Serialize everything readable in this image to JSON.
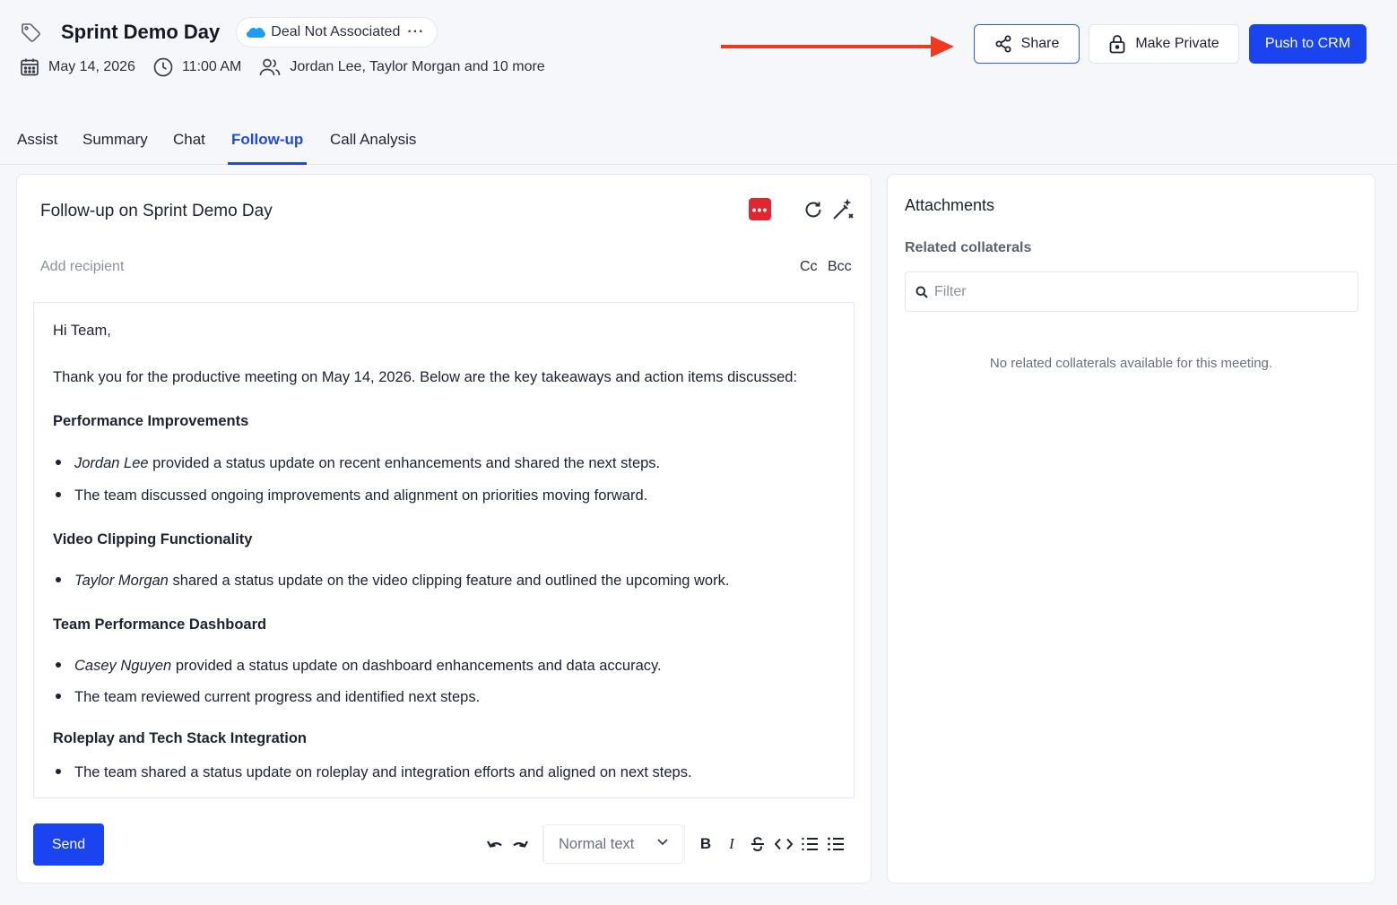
{
  "header": {
    "title": "Sprint Demo Day",
    "deal_status": "Deal Not Associated",
    "deal_more": "···",
    "date": "May 14, 2026",
    "time": "11:00 AM",
    "participants": "Jordan Lee, Taylor Morgan and 10 more",
    "share_label": "Share",
    "private_label": "Make Private",
    "crm_label": "Push to CRM",
    "annotation_arrow_color": "#f03a1f",
    "accent_color": "#1a44f0"
  },
  "tabs": [
    {
      "label": "Assist"
    },
    {
      "label": "Summary"
    },
    {
      "label": "Chat"
    },
    {
      "label": "Follow-up",
      "active": true
    },
    {
      "label": "Call Analysis"
    }
  ],
  "followup": {
    "subject": "Follow-up on Sprint Demo Day",
    "badge": "•••",
    "recipient_placeholder": "Add recipient",
    "cc_label": "Cc",
    "bcc_label": "Bcc",
    "body": {
      "greeting": "Hi Team,",
      "intro": "Thank you for the productive meeting on May 14, 2026. Below are the key takeaways and action items discussed:",
      "sections": [
        {
          "heading": "Performance Improvements",
          "bullets": [
            {
              "name": "Jordan Lee",
              "text": " provided a status update on recent enhancements and shared the next steps."
            },
            {
              "name": "",
              "text": "The team discussed ongoing improvements and alignment on priorities moving forward."
            }
          ]
        },
        {
          "heading": "Video Clipping Functionality",
          "bullets": [
            {
              "name": "Taylor Morgan",
              "text": " shared a status update on the video clipping feature and outlined the upcoming work."
            }
          ]
        },
        {
          "heading": "Team Performance Dashboard",
          "bullets": [
            {
              "name": "Casey Nguyen",
              "text": " provided a status update on dashboard enhancements and data accuracy."
            },
            {
              "name": "",
              "text": "The team reviewed current progress and identified next steps."
            }
          ]
        },
        {
          "heading": "Roleplay and Tech Stack Integration",
          "bullets": [
            {
              "name": "",
              "text": "The team shared a status update on roleplay and integration efforts and aligned on next steps."
            }
          ]
        }
      ]
    },
    "send_label": "Send",
    "text_style": "Normal text"
  },
  "attachments": {
    "title": "Attachments",
    "related_title": "Related collaterals",
    "filter_placeholder": "Filter",
    "empty_message": "No related collaterals available for this meeting."
  }
}
